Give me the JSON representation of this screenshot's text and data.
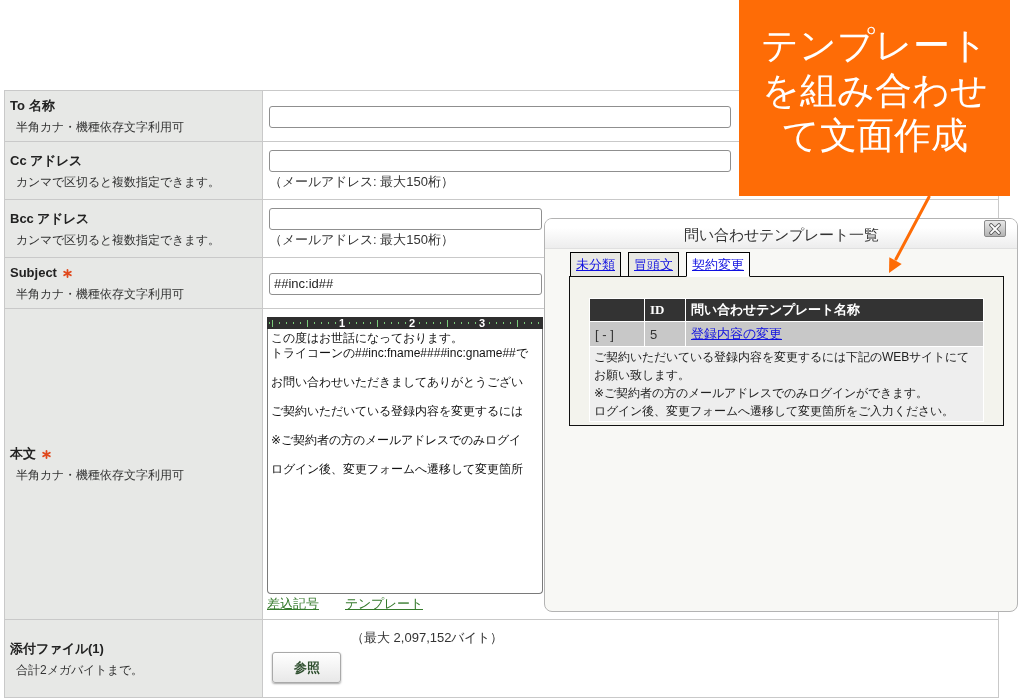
{
  "form": {
    "rows": [
      {
        "kind": "input",
        "label": "To 名称",
        "required": false,
        "hint": "半角カナ・機種依存文字利用可"
      },
      {
        "kind": "input",
        "label": "Cc アドレス",
        "required": false,
        "hint": "カンマで区切ると複数指定できます。",
        "note": "（メールアドレス: 最大150桁）"
      },
      {
        "kind": "short-input",
        "label": "Bcc アドレス",
        "required": false,
        "hint": "カンマで区切ると複数指定できます。",
        "note": "（メールアドレス: 最大150桁）"
      },
      {
        "kind": "short-input",
        "label": "Subject",
        "required": true,
        "hint": "半角カナ・機種依存文字利用可",
        "value": "##inc:id##"
      },
      {
        "kind": "editor",
        "label": "本文",
        "required": true,
        "hint": "半角カナ・機種依存文字利用可",
        "ruler": [
          "1",
          "2",
          "3"
        ],
        "paragraphs": [
          [
            "この度はお世話になっております。",
            "トライコーンの##inc:fname####inc:gname##で"
          ],
          [
            "お問い合わせいただきましてありがとうござい"
          ],
          [
            "ご契約いただいている登録内容を変更するには"
          ],
          [
            "※ご契約者の方のメールアドレスでのみログイ"
          ],
          [
            "ログイン後、変更フォームへ遷移して変更箇所"
          ]
        ],
        "links": [
          "差込記号",
          "テンプレート"
        ]
      },
      {
        "kind": "file",
        "label": "添付ファイル(1)",
        "required": false,
        "hint": "合計2メガバイトまで。",
        "note": "（最大 2,097,152バイト）",
        "button": "参照"
      }
    ]
  },
  "dialog": {
    "title": "問い合わせテンプレート一覧",
    "tabs": [
      {
        "label": "未分類",
        "selected": false
      },
      {
        "label": "冒頭文",
        "selected": false
      },
      {
        "label": "契約変更",
        "selected": true
      }
    ],
    "table": {
      "columns": [
        "ID",
        "問い合わせテンプレート名称"
      ],
      "rows": [
        {
          "toggle": "[ - ]",
          "id": "5",
          "name": "登録内容の変更",
          "expanded": true,
          "preview": [
            "ご契約いただいている登録内容を変更するには下記のWEBサイトにてお願い致します。",
            "※ご契約者の方のメールアドレスでのみログインができます。",
            "ログイン後、変更フォームへ遷移して変更箇所をご入力ください。"
          ]
        }
      ]
    }
  },
  "callout": {
    "text": "テンプレートを組み合わせて文面作成"
  }
}
